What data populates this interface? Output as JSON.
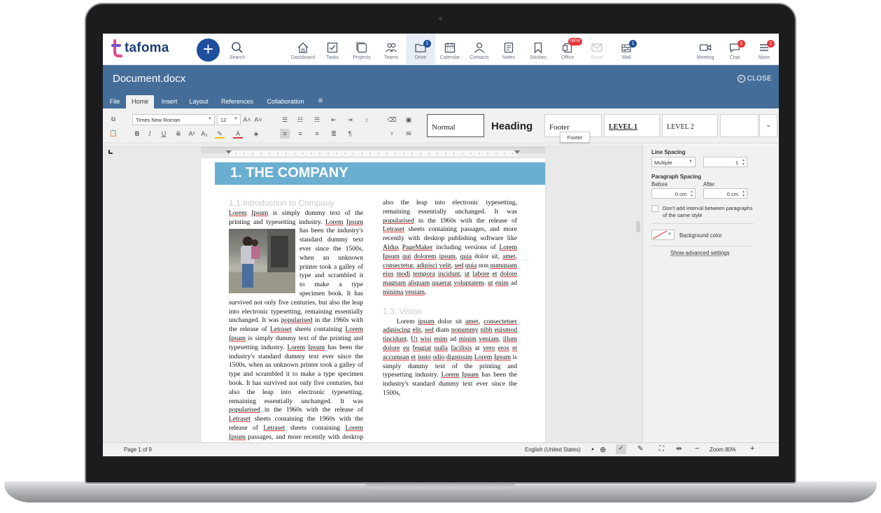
{
  "app": {
    "logo_text": "tafoma"
  },
  "nav": {
    "search": "Search",
    "items": [
      {
        "label": "Dashboard",
        "icon": "home-icon"
      },
      {
        "label": "Tasks",
        "icon": "checkbox-icon"
      },
      {
        "label": "Projects",
        "icon": "projects-icon"
      },
      {
        "label": "Teams",
        "icon": "teams-icon"
      },
      {
        "label": "Drive",
        "icon": "folder-icon",
        "badge": "1"
      },
      {
        "label": "Calendar",
        "icon": "calendar-icon"
      },
      {
        "label": "Contacts",
        "icon": "contact-icon"
      },
      {
        "label": "Notes",
        "icon": "notes-icon"
      },
      {
        "label": "Stickies",
        "icon": "bookmark-icon"
      },
      {
        "label": "Office",
        "icon": "office-icon",
        "badge": "NEW"
      },
      {
        "label": "Email",
        "icon": "mail-icon"
      },
      {
        "label": "Wall",
        "icon": "wall-icon",
        "badge": "1"
      }
    ],
    "meeting": "Meeting",
    "chat": "Chat",
    "chat_badge": "2",
    "more": "More",
    "more_badge": "2"
  },
  "document": {
    "title": "Document.docx",
    "close": "CLOSE"
  },
  "menu_tabs": [
    "File",
    "Home",
    "Insert",
    "Layout",
    "References",
    "Collaboration"
  ],
  "toolbar": {
    "font_name": "Times New Roman",
    "font_size": "12",
    "styles": [
      "Normal",
      "Heading",
      "Footer",
      "LEVEL 1",
      "LEVEL 2"
    ],
    "tooltip": "Footer"
  },
  "page": {
    "banner": "1. THE COMPANY",
    "col1_heading": "1.1.Introduction to Company",
    "col2_heading": "1.3. Vision"
  },
  "right_panel": {
    "line_spacing_label": "Line Spacing",
    "line_spacing_mode": "Multiple",
    "line_spacing_value": "1",
    "paragraph_spacing_label": "Paragraph Spacing",
    "before_label": "Before",
    "after_label": "After",
    "before_value": "0 cm",
    "after_value": "0 cm",
    "dont_add_interval": "Don't add interval between paragraphs of the same style",
    "background_color": "Background color",
    "advanced": "Show advanced settings"
  },
  "status": {
    "page": "Page 1 of 9",
    "language": "English (United States)",
    "zoom": "Zoom 80%"
  },
  "colors": {
    "accent": "#446e99",
    "brand": "#1f4f9c",
    "badge_red": "#e5363b"
  }
}
